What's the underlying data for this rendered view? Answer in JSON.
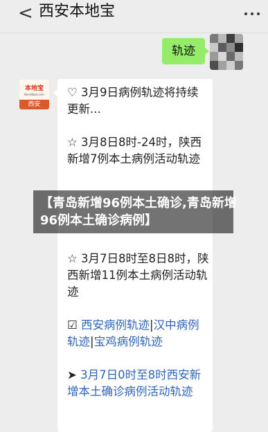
{
  "header": {
    "back_glyph": "<",
    "title": "西安本地宝",
    "menu_icon": "more-dots-icon"
  },
  "chat": {
    "sent_message": "轨迹",
    "bot_avatar": {
      "brand": "本地宝",
      "domain": "Bendibao.com",
      "city": "西安"
    },
    "reply": {
      "p1": "♡ 3月9日病例轨迹将持续更新...",
      "p2": "☆ 3月8日8时-24时，陕西新增7例本土病例活动轨迹",
      "p3": "☆ 3月7日8时至8日8时，陕西新增11例本土病例活动轨迹",
      "p4_mark": "☑",
      "p4_link1": "西安病例轨迹",
      "p4_sep1": "|",
      "p4_link2": "汉中病例轨迹",
      "p4_sep2": "|",
      "p4_link3": "宝鸡病例轨迹",
      "p5_prefix": "➤ ",
      "p5_link": "3月7日0时至8时西安新增本土确诊病例活动轨迹"
    }
  },
  "overlay": {
    "text": "【青岛新增96例本土确诊,青岛新增96例本土确诊病例】"
  },
  "colors": {
    "background": "#ededed",
    "sent_bubble": "#95ec69",
    "link": "#2f64b8",
    "brand_orange": "#d95b2d"
  }
}
